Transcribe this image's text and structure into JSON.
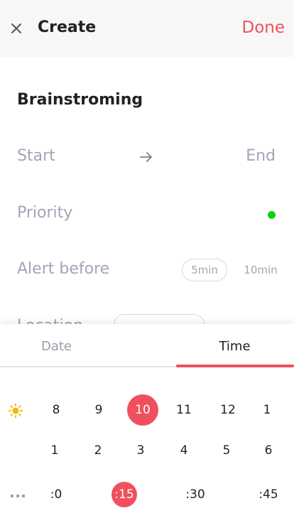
{
  "header": {
    "title": "Create",
    "done_label": "Done"
  },
  "event": {
    "title": "Brainstroming"
  },
  "rows": {
    "start_label": "Start",
    "end_label": "End",
    "priority_label": "Priority",
    "alert_label": "Alert before",
    "alert_options": [
      "5min",
      "10min"
    ],
    "location_label": "Location"
  },
  "colors": {
    "accent": "#f0505d",
    "priority": "#0bd40b",
    "muted": "#a3a5b5",
    "sun": "#f7b500",
    "moon": "#3b2f8a"
  },
  "picker": {
    "tabs": [
      "Date",
      "Time"
    ],
    "active_tab": "Time",
    "am_hours": [
      "8",
      "9",
      "10",
      "11",
      "12",
      "1"
    ],
    "pm_hours": [
      "1",
      "2",
      "3",
      "4",
      "5",
      "6"
    ],
    "minutes": [
      ":0",
      ":15",
      ":30",
      ":45"
    ],
    "selected_hour": "10",
    "selected_minute": ":15"
  }
}
